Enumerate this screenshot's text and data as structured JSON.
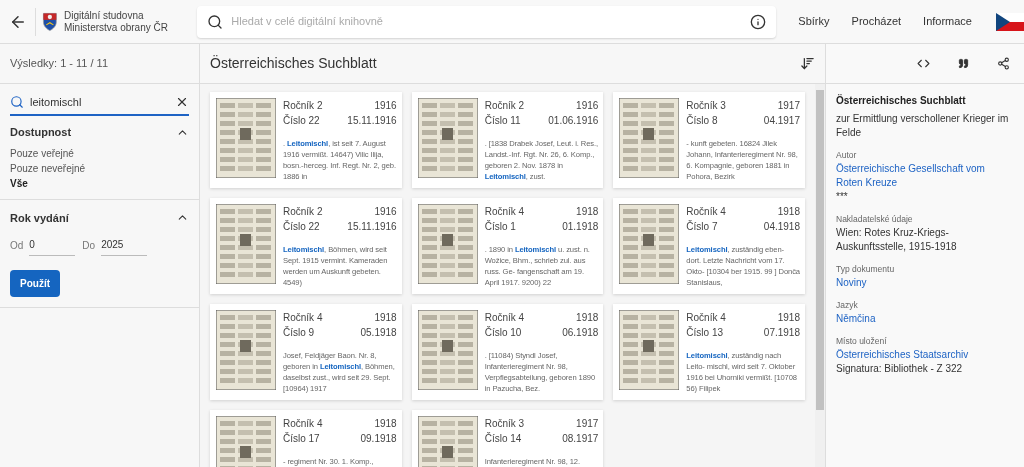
{
  "header": {
    "site_name": "Digitální studovna Ministerstva obrany ČR",
    "search": {
      "placeholder": "Hledat v celé digitální knihovně"
    },
    "nav": [
      {
        "label": "Sbírky"
      },
      {
        "label": "Procházet"
      },
      {
        "label": "Informace"
      }
    ]
  },
  "sidebar": {
    "results": "Výsledky: 1 - 11 / 11",
    "query": "leitomischl",
    "availability": {
      "title": "Dostupnost",
      "expanded": true,
      "options": [
        {
          "label": "Pouze veřejné",
          "selected": false
        },
        {
          "label": "Pouze neveřejné",
          "selected": false
        },
        {
          "label": "Vše",
          "selected": true
        }
      ]
    },
    "year": {
      "title": "Rok vydání",
      "expanded": true,
      "from_label": "Od",
      "from": "0",
      "to_label": "Do",
      "to": "2025",
      "apply": "Použít"
    }
  },
  "results": {
    "title": "Österreichisches Suchblatt",
    "cards": [
      {
        "volume": "Ročník 2",
        "year": "1916",
        "issue": "Číslo 22",
        "date": "15.11.1916",
        "snippet": ". **Leitomischl**, ist seit 7. August 1916 vermißt. 14647) Vilic Ilija, bosn.-herceg. Inf. Regt. Nr. 2, geb. 1886 in"
      },
      {
        "volume": "Ročník 2",
        "year": "1916",
        "issue": "Číslo 11",
        "date": "01.06.1916",
        "snippet": ". [1838 Drabek Josef, Leut. i. Res., Landst.-Inf. Rgt. Nr. 26, 6. Komp., geboren 2. Nov. 1878 in **Leitomischl**, zust."
      },
      {
        "volume": "Ročník 3",
        "year": "1917",
        "issue": "Číslo 8",
        "date": "04.1917",
        "snippet": "- kunft gebeten. 16824 Jilek Johann, Infanterieregiment Nr. 98, 6. Kompagnie, geboren 1881 in Pohora, Bezirk"
      },
      {
        "volume": "Ročník 2",
        "year": "1916",
        "issue": "Číslo 22",
        "date": "15.11.1916",
        "snippet": "**Leitomischl**, Böhmen, wird seit Sept. 1915 vermint. Kameraden werden um Auskunft gebeten. 4549)"
      },
      {
        "volume": "Ročník 4",
        "year": "1918",
        "issue": "Číslo 1",
        "date": "01.1918",
        "snippet": ". 1890 in **Leitomischl** u. zust. n. Wožice, Bhm., schrieb zul. aus russ. Ge- fangenschaft am 19. April 1917. 9200) 22"
      },
      {
        "volume": "Ročník 4",
        "year": "1918",
        "issue": "Číslo 7",
        "date": "04.1918",
        "snippet": "**Leitomischl**, zuständig eben- dort. Letzte Nachricht vom 17. Okto- [10304 ber 1915. 99 ] Donča Stanislaus,"
      },
      {
        "volume": "Ročník 4",
        "year": "1918",
        "issue": "Číslo 9",
        "date": "05.1918",
        "snippet": "Josef, Feldjäger Baon. Nr. 8, geboren in **Leitomischl**, Böhmen, daselbst zust., wird seit 29. Sept. [10964) 1917"
      },
      {
        "volume": "Ročník 4",
        "year": "1918",
        "issue": "Číslo 10",
        "date": "06.1918",
        "snippet": ". [11084) Styndl Josef, Infanterieregiment Nr. 98, Verpflegsabteilung, geboren 1890 in Pazucha, Bez."
      },
      {
        "volume": "Ročník 4",
        "year": "1918",
        "issue": "Číslo 13",
        "date": "07.1918",
        "snippet": "**Leitomischl**, zuständig nach Leito- mischl, wird seit 7. Oktober 1916 bei Uhorniki vermißt. [10708 56) Filipek"
      },
      {
        "volume": "Ročník 4",
        "year": "1918",
        "issue": "Číslo 17",
        "date": "09.1918",
        "snippet": "- regiment Nr. 30. 1. Komp.,"
      },
      {
        "volume": "Ročník 3",
        "year": "1917",
        "issue": "Číslo 14",
        "date": "08.1917",
        "snippet": "Infanterieregiment Nr. 98, 12."
      }
    ]
  },
  "details": {
    "title": "Österreichisches Suchblatt",
    "subtitle": "zur Ermittlung verschollener Krieger im Felde",
    "fields": [
      {
        "label": "Autor",
        "values": [
          {
            "text": "Österreichische Gesellschaft vom Roten Kreuze",
            "link": true
          },
          {
            "text": "***",
            "link": false
          }
        ]
      },
      {
        "label": "Nakladatelské údaje",
        "values": [
          {
            "text": "Wien: Rotes Kruz-Kriegs-Auskunftsstelle, 1915-1918",
            "link": false
          }
        ]
      },
      {
        "label": "Typ dokumentu",
        "values": [
          {
            "text": "Noviny",
            "link": true
          }
        ]
      },
      {
        "label": "Jazyk",
        "values": [
          {
            "text": "Němčina",
            "link": true
          }
        ]
      },
      {
        "label": "Místo uložení",
        "values": [
          {
            "text": "Österreichisches Staatsarchiv",
            "link": true
          },
          {
            "text": "Signatura: Bibliothek - Z 322",
            "link": false
          }
        ]
      }
    ]
  }
}
